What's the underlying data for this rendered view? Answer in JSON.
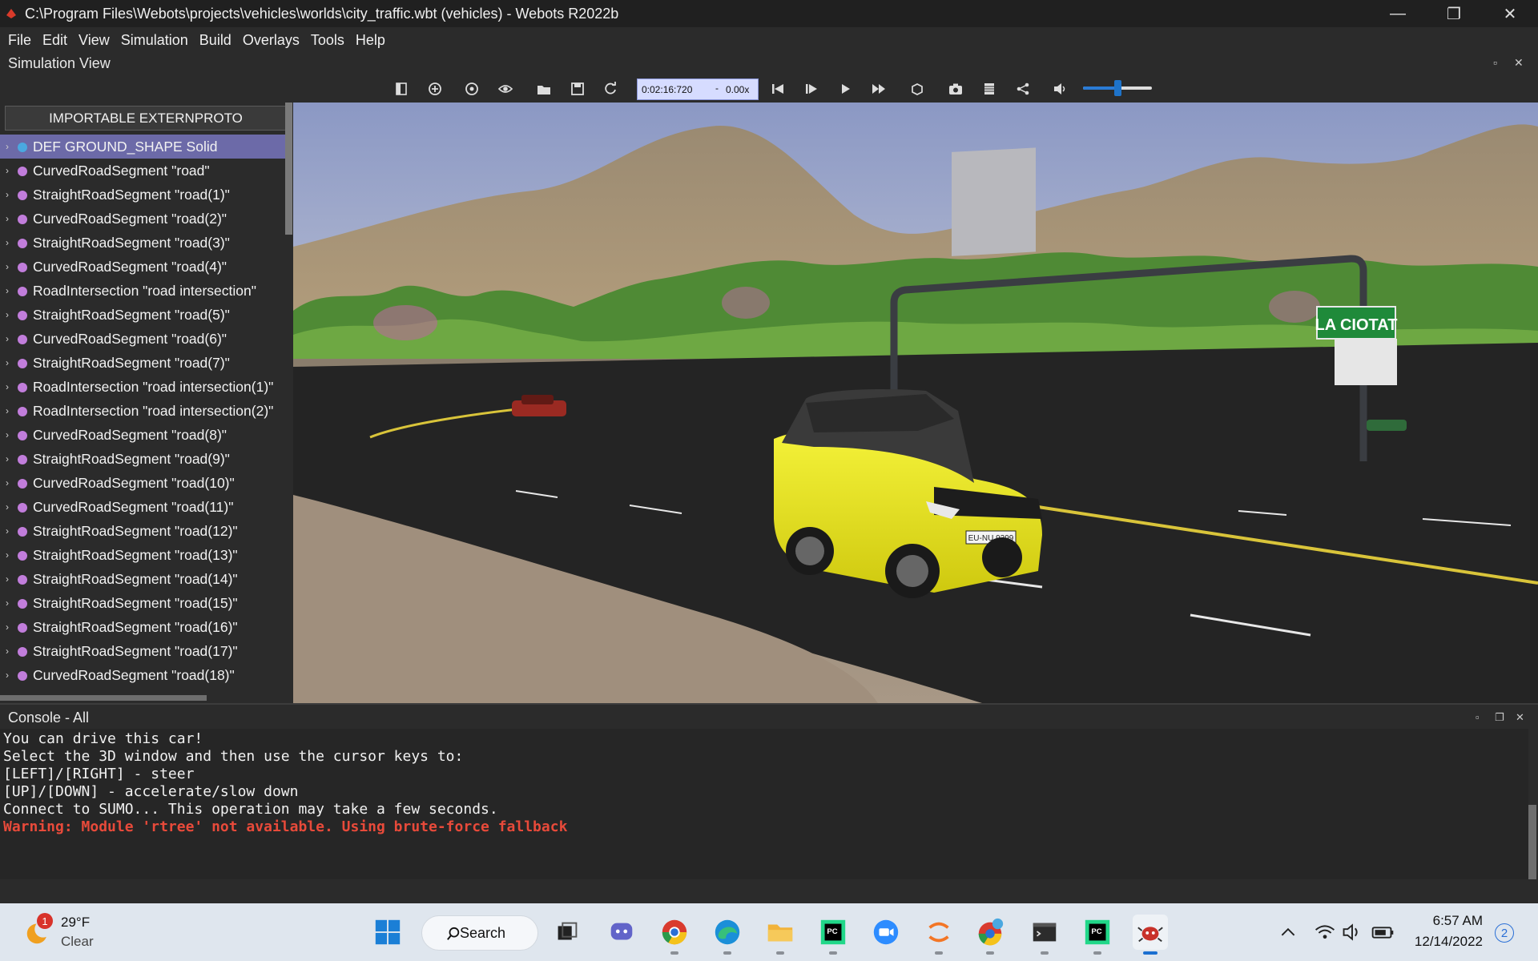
{
  "window": {
    "title": "C:\\Program Files\\Webots\\projects\\vehicles\\worlds\\city_traffic.wbt (vehicles) - Webots R2022b",
    "minimize": "—",
    "maximize": "❐",
    "close": "✕"
  },
  "menu": [
    "File",
    "Edit",
    "View",
    "Simulation",
    "Build",
    "Overlays",
    "Tools",
    "Help"
  ],
  "sim_view": {
    "label": "Simulation View"
  },
  "toolbar": {
    "time": "0:02:16:720",
    "separator": "-",
    "speed": "0.00x",
    "volume_fraction": 0.5
  },
  "scene_tree": {
    "proto_button": "IMPORTABLE EXTERNPROTO",
    "nodes": [
      "DEF GROUND_SHAPE Solid",
      "CurvedRoadSegment \"road\"",
      "StraightRoadSegment \"road(1)\"",
      "CurvedRoadSegment \"road(2)\"",
      "StraightRoadSegment \"road(3)\"",
      "CurvedRoadSegment \"road(4)\"",
      "RoadIntersection \"road intersection\"",
      "StraightRoadSegment \"road(5)\"",
      "CurvedRoadSegment \"road(6)\"",
      "StraightRoadSegment \"road(7)\"",
      "RoadIntersection \"road intersection(1)\"",
      "RoadIntersection \"road intersection(2)\"",
      "CurvedRoadSegment \"road(8)\"",
      "StraightRoadSegment \"road(9)\"",
      "CurvedRoadSegment \"road(10)\"",
      "CurvedRoadSegment \"road(11)\"",
      "StraightRoadSegment \"road(12)\"",
      "StraightRoadSegment \"road(13)\"",
      "StraightRoadSegment \"road(14)\"",
      "StraightRoadSegment \"road(15)\"",
      "StraightRoadSegment \"road(16)\"",
      "StraightRoadSegment \"road(17)\"",
      "CurvedRoadSegment \"road(18)\""
    ]
  },
  "scene": {
    "sign_text": "LA CIOTAT",
    "plate_text": "EU-NU 9299"
  },
  "console": {
    "label": "Console - All",
    "lines": [
      "You can drive this car!",
      "Select the 3D window and then use the cursor keys to:",
      "[LEFT]/[RIGHT] - steer",
      "[UP]/[DOWN] - accelerate/slow down",
      "Connect to SUMO... This operation may take a few seconds."
    ],
    "warning": "Warning: Module 'rtree' not available. Using brute-force fallback"
  },
  "taskbar": {
    "weather_badge": "1",
    "temperature": "29°F",
    "condition": "Clear",
    "search_label": "Search",
    "time": "6:57 AM",
    "date": "12/14/2022",
    "notifications": "2"
  },
  "colors": {
    "selection": "#6c6aa8",
    "warning": "#e84a3a",
    "time_box": "#d6dcff",
    "car_body": "#f2ef1a",
    "sign_green": "#1f8a3a"
  }
}
